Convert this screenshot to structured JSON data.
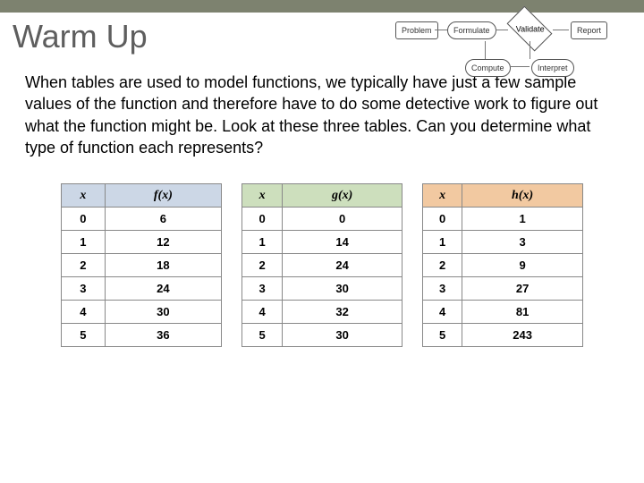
{
  "title": "Warm Up",
  "paragraph": "When tables are used to model functions, we typically have just a few sample values of the function and therefore have to do some detective work to figure out what the function might be. Look at these three tables. Can you determine what type of function each represents?",
  "diagram": {
    "nodes": [
      "Problem",
      "Formulate",
      "Validate",
      "Report",
      "Compute",
      "Interpret"
    ]
  },
  "tables": [
    {
      "headerClass": "hd-blue",
      "cols": [
        "x",
        "f(x)"
      ],
      "rows": [
        [
          "0",
          "6"
        ],
        [
          "1",
          "12"
        ],
        [
          "2",
          "18"
        ],
        [
          "3",
          "24"
        ],
        [
          "4",
          "30"
        ],
        [
          "5",
          "36"
        ]
      ]
    },
    {
      "headerClass": "hd-green",
      "cols": [
        "x",
        "g(x)"
      ],
      "rows": [
        [
          "0",
          "0"
        ],
        [
          "1",
          "14"
        ],
        [
          "2",
          "24"
        ],
        [
          "3",
          "30"
        ],
        [
          "4",
          "32"
        ],
        [
          "5",
          "30"
        ]
      ]
    },
    {
      "headerClass": "hd-orange",
      "cols": [
        "x",
        "h(x)"
      ],
      "rows": [
        [
          "0",
          "1"
        ],
        [
          "1",
          "3"
        ],
        [
          "2",
          "9"
        ],
        [
          "3",
          "27"
        ],
        [
          "4",
          "81"
        ],
        [
          "5",
          "243"
        ]
      ]
    }
  ]
}
